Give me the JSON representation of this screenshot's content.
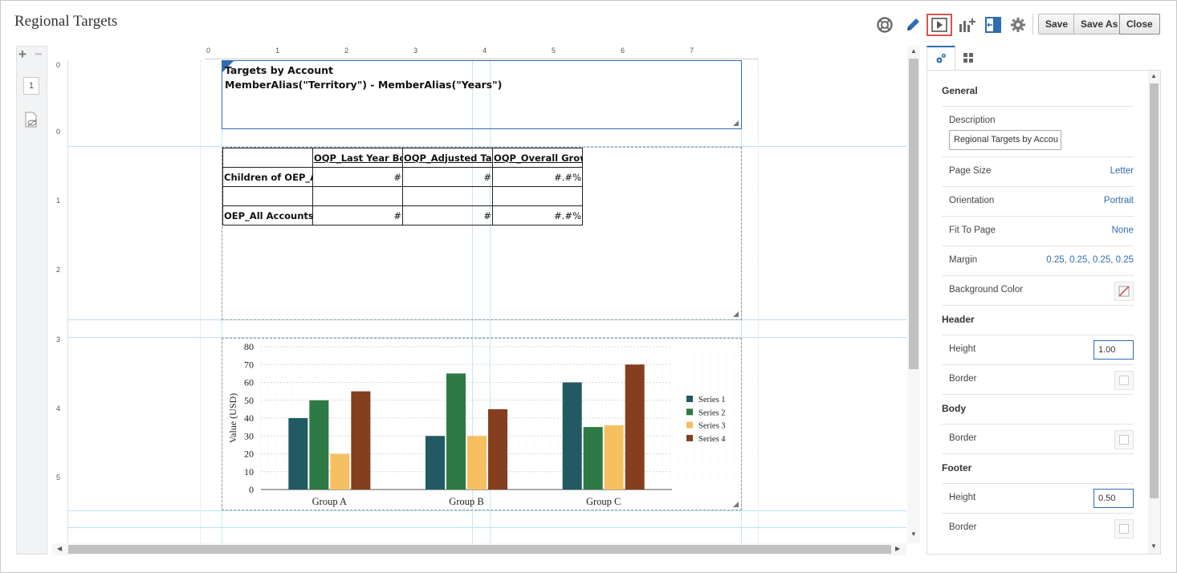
{
  "app": {
    "title": "Regional Targets"
  },
  "toolbar": {
    "icons": [
      "help-icon",
      "edit-icon",
      "preview-icon",
      "insert-chart-icon",
      "fit-width-icon",
      "settings-icon"
    ],
    "save_label": "Save",
    "save_as_label": "Save As",
    "close_label": "Close"
  },
  "left_strip": {
    "page_number": "1"
  },
  "rulers": {
    "horizontal": [
      "0",
      "1",
      "2",
      "3",
      "4",
      "5",
      "6",
      "7"
    ],
    "vertical": [
      "0",
      "0",
      "1",
      "2",
      "3",
      "4",
      "5"
    ]
  },
  "report": {
    "header": {
      "title": "Targets by Account",
      "subtitle": "MemberAlias(\"Territory\") - MemberAlias(\"Years\")"
    },
    "grid": {
      "columns": [
        "",
        "OQP_Last Year Boo",
        "OQP_Adjusted Targ",
        "OQP_Overall Growt"
      ],
      "rows": [
        [
          "Children of OEP_Al",
          "#",
          "#",
          "#.#%"
        ],
        [
          "",
          "",
          "",
          ""
        ],
        [
          "OEP_All Accounts",
          "#",
          "#",
          "#.#%"
        ]
      ]
    }
  },
  "chart_data": {
    "type": "bar",
    "categories": [
      "Group A",
      "Group B",
      "Group C"
    ],
    "series": [
      {
        "name": "Series 1",
        "values": [
          40,
          30,
          60
        ]
      },
      {
        "name": "Series 2",
        "values": [
          50,
          65,
          35
        ]
      },
      {
        "name": "Series 3",
        "values": [
          20,
          30,
          36
        ]
      },
      {
        "name": "Series 4",
        "values": [
          55,
          45,
          70
        ]
      }
    ],
    "colors": [
      "#225a63",
      "#2e7a44",
      "#f6c060",
      "#843f1e"
    ],
    "ylabel": "Value (USD)",
    "xlabel": "",
    "ylim": [
      0,
      80
    ],
    "yticks": [
      "0",
      "10",
      "20",
      "30",
      "40",
      "50",
      "60",
      "70",
      "80"
    ],
    "legend": "right",
    "grid": true
  },
  "properties": {
    "tabs": [
      "properties-tab",
      "layout-tab"
    ],
    "general_heading": "General",
    "description_label": "Description",
    "description_value": "Regional Targets by Accou",
    "page_size_label": "Page Size",
    "page_size_value": "Letter",
    "orientation_label": "Orientation",
    "orientation_value": "Portrait",
    "fit_label": "Fit To Page",
    "fit_value": "None",
    "margin_label": "Margin",
    "margin_value": "0.25, 0.25, 0.25, 0.25",
    "bg_label": "Background Color",
    "header_heading": "Header",
    "header_height_label": "Height",
    "header_height_value": "1.00",
    "header_border_label": "Border",
    "body_heading": "Body",
    "body_border_label": "Border",
    "footer_heading": "Footer",
    "footer_height_label": "Height",
    "footer_height_value": "0.50",
    "footer_border_label": "Border"
  }
}
